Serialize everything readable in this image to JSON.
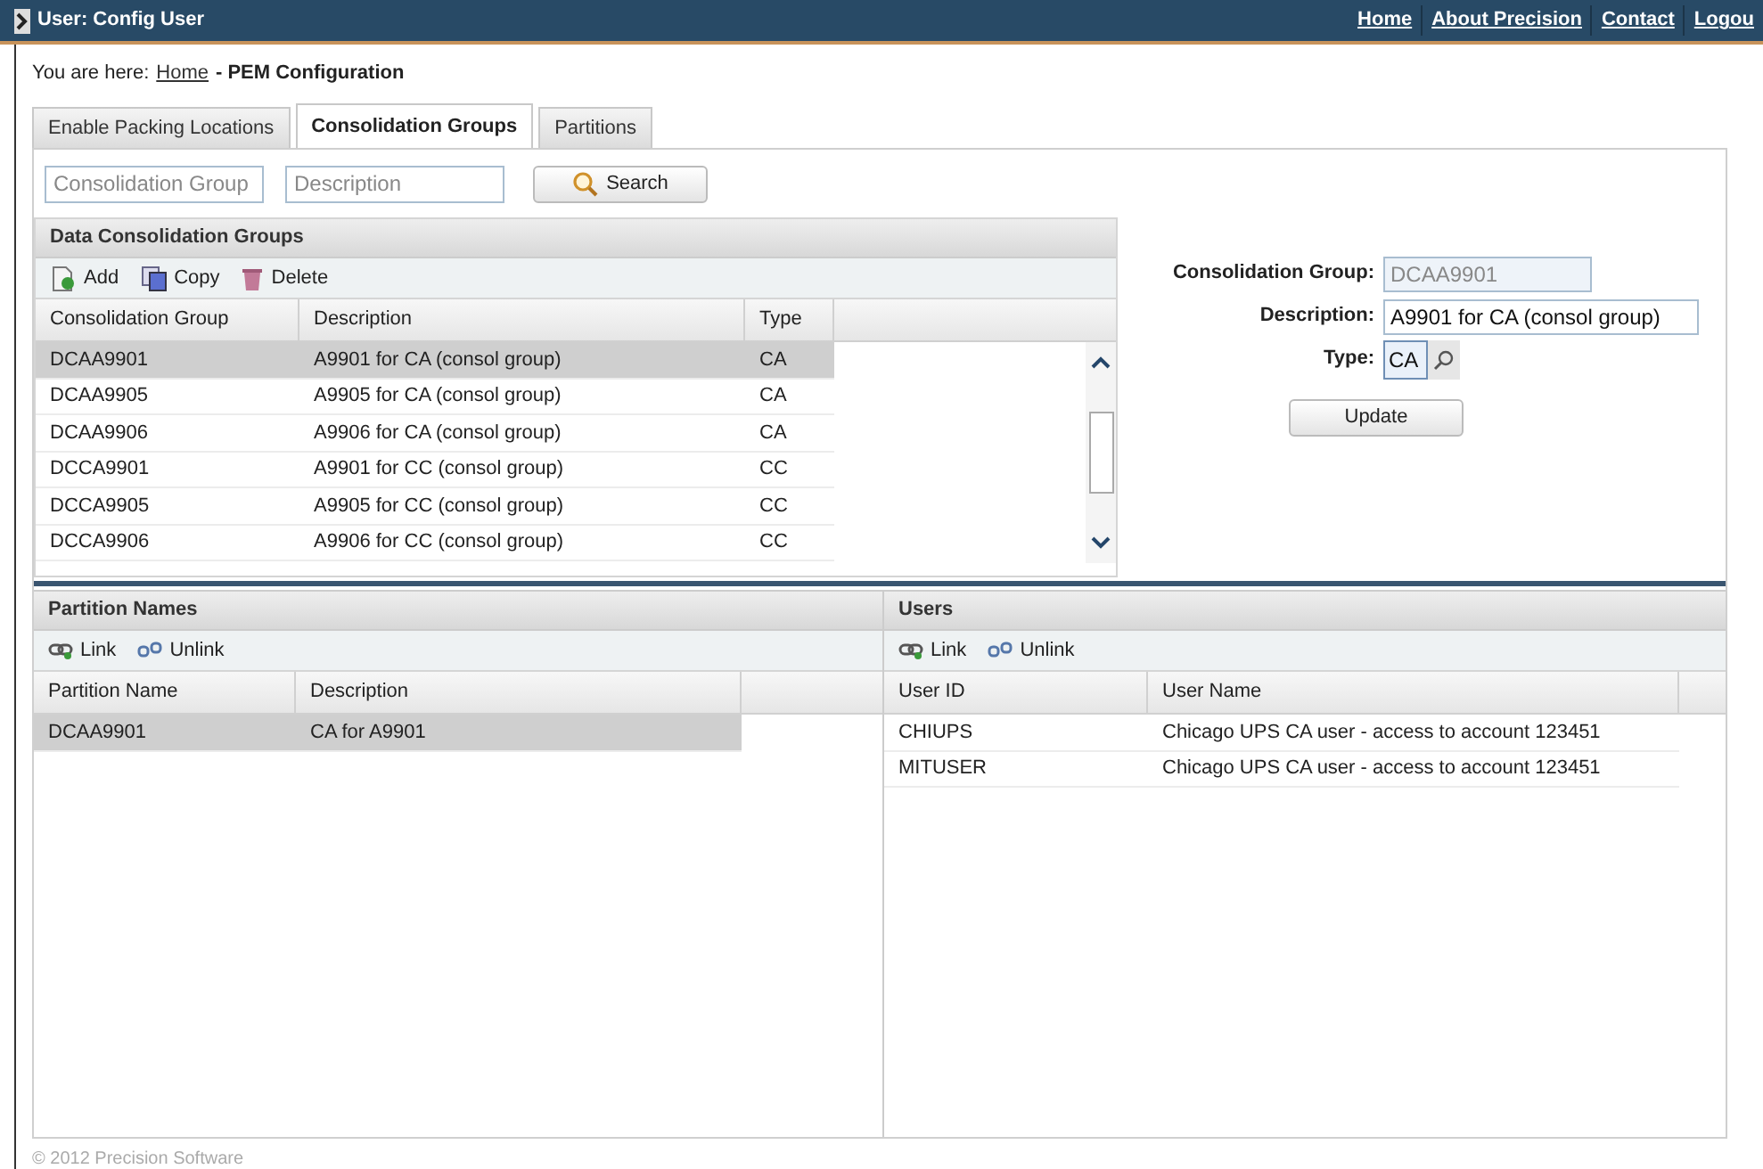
{
  "window": {
    "title": "User: Config User"
  },
  "top_links": [
    {
      "label": "Home"
    },
    {
      "label": "About Precision"
    },
    {
      "label": "Contact"
    },
    {
      "label": "Logou"
    }
  ],
  "breadcrumb": {
    "prefix": "You are here:",
    "link": "Home",
    "current": "- PEM Configuration"
  },
  "tabs": [
    {
      "label": "Enable Packing Locations",
      "selected": false
    },
    {
      "label": "Consolidation Groups",
      "selected": true
    },
    {
      "label": "Partitions",
      "selected": false
    }
  ],
  "search": {
    "fields": [
      {
        "placeholder": "Consolidation Group"
      },
      {
        "placeholder": "Description"
      }
    ],
    "button": "Search"
  },
  "groups": {
    "title": "Data Consolidation Groups",
    "toolbar": [
      {
        "kind": "add",
        "label": "Add"
      },
      {
        "kind": "copy",
        "label": "Copy"
      },
      {
        "kind": "delete",
        "label": "Delete"
      }
    ],
    "columns": [
      "Consolidation Group",
      "Description",
      "Type"
    ],
    "rows": [
      {
        "cells": [
          "DCAA9901",
          "A9901 for CA (consol group)",
          "CA"
        ],
        "selected": true
      },
      {
        "cells": [
          "DCAA9905",
          "A9905 for CA (consol group)",
          "CA"
        ],
        "selected": false
      },
      {
        "cells": [
          "DCAA9906",
          "A9906 for CA (consol group)",
          "CA"
        ],
        "selected": false
      },
      {
        "cells": [
          "DCCA9901",
          "A9901 for CC (consol group)",
          "CC"
        ],
        "selected": false
      },
      {
        "cells": [
          "DCCA9905",
          "A9905 for CC (consol group)",
          "CC"
        ],
        "selected": false
      },
      {
        "cells": [
          "DCCA9906",
          "A9906 for CC (consol group)",
          "CC"
        ],
        "selected": false
      }
    ]
  },
  "form": {
    "fields": [
      {
        "label": "Consolidation Group:",
        "value": "DCAA9901",
        "disabled": true
      },
      {
        "label": "Description:",
        "value": "A9901 for CA (consol group)",
        "disabled": false
      },
      {
        "label": "Type:",
        "value": "CA",
        "disabled": false
      }
    ],
    "button": "Update"
  },
  "partitions": {
    "title": "Partition Names",
    "toolbar": [
      {
        "kind": "link",
        "label": "Link"
      },
      {
        "kind": "unlink",
        "label": "Unlink"
      }
    ],
    "columns": [
      "Partition Name",
      "Description"
    ],
    "rows": [
      {
        "cells": [
          "DCAA9901",
          "CA for A9901"
        ],
        "selected": true
      }
    ]
  },
  "users": {
    "title": "Users",
    "toolbar": [
      {
        "kind": "link",
        "label": "Link"
      },
      {
        "kind": "unlink",
        "label": "Unlink"
      }
    ],
    "columns": [
      "User ID",
      "User Name"
    ],
    "rows": [
      {
        "cells": [
          "CHIUPS",
          "Chicago UPS CA user - access to account 123451"
        ],
        "selected": false
      },
      {
        "cells": [
          "MITUSER",
          "Chicago UPS CA user - access to account 123451"
        ],
        "selected": false
      }
    ]
  },
  "footer": "© 2012 Precision Software"
}
